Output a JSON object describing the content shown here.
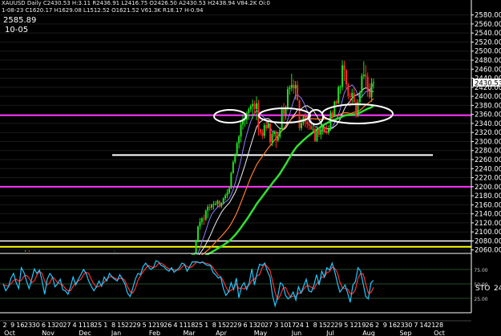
{
  "header": {
    "line1": "XAUUSD Daily  C2430.53 H:3.11 R2436.91 L2416.75 O2426.50 A2430.53 H2438.94  V84.2K  Oi:0",
    "line2": "1-08-23 C1620.17 H1629.08 L1512.52 O1621.52 V61.3K R18.17 H-0.94",
    "price_readout": "2585.89",
    "date_readout": "10-05"
  },
  "colors": {
    "background": "#000000",
    "up_candle": "#22e022",
    "down_candle": "#ff2a2a",
    "magenta_line": "#ff33ff",
    "white_line": "#ffffff",
    "yellow_line": "#ffff00",
    "ma_fast": "#8a7cff",
    "ma_mid": "#f2f2f2",
    "ma_slow": "#ff7a2a",
    "ma_long": "#33dd33",
    "sto_k": "#22c8ff",
    "sto_d": "#ff3030",
    "grid": "#d0d0d0"
  },
  "chart_data": {
    "type": "candlestick",
    "y_axis": {
      "range": [
        2056,
        2590
      ],
      "ticks": [
        2580,
        2560,
        2540,
        2520,
        2500,
        2480,
        2460,
        2440,
        2420,
        2400,
        2380,
        2360,
        2340,
        2320,
        2300,
        2280,
        2260,
        2240,
        2220,
        2200,
        2180,
        2160,
        2140,
        2120,
        2100,
        2080,
        2060
      ],
      "tick_labels": [
        "2580.00",
        "2560.00",
        "2540.00",
        "2520.00",
        "2500.00",
        "2480.00",
        "2460.00",
        "2440.00",
        "2420.00",
        "2400.00",
        "2380.00",
        "2360.00",
        "2340.00",
        "2320.00",
        "2300.00",
        "2280.00",
        "2260.00",
        "2240.00",
        "2220.00",
        "2200.00",
        "2180.00",
        "2160.00",
        "2140.00",
        "2120.00",
        "2100.00",
        "2080.00",
        "2060.00"
      ],
      "last_price_label": "2430.53",
      "last_price": 2430.53
    },
    "x_axis": {
      "day_labels": [
        "2",
        "9",
        "16",
        "23",
        "30",
        "6",
        "13",
        "20",
        "27",
        "4",
        "11",
        "18",
        "25",
        "1",
        "8",
        "15",
        "22",
        "29",
        "5",
        "12",
        "19",
        "26",
        "4",
        "11",
        "18",
        "25",
        "1",
        "8",
        "15",
        "22",
        "29",
        "6",
        "13",
        "20",
        "27",
        "3",
        "10",
        "17",
        "24",
        "1",
        "8",
        "15",
        "22",
        "29",
        "5",
        "12",
        "19",
        "26",
        "2",
        "9",
        "16",
        "23",
        "30",
        "7",
        "14",
        "21",
        "28"
      ],
      "month_labels": [
        "Oct",
        "Nov",
        "Dec",
        "Jan",
        "Feb",
        "Mar",
        "Apr",
        "May",
        "Jun",
        "Jul",
        "Aug",
        "Sep",
        "Oct"
      ]
    },
    "price_series": [
      [
        2031.5,
        2040.0,
        2031.0,
        2039.2
      ],
      [
        2039.2,
        2043.5,
        2033.3,
        2035.9
      ],
      [
        2035.9,
        2045.4,
        2029.8,
        2032.7
      ],
      [
        2032.7,
        2045.0,
        2022.4,
        2042.8
      ],
      [
        2042.8,
        2048.2,
        2036.7,
        2039.9
      ],
      [
        2039.9,
        2042.8,
        2037.7,
        2040.8
      ],
      [
        2040.8,
        2059.9,
        2038.4,
        2057.9
      ],
      [
        2057.9,
        2059.6,
        2037.9,
        2042.2
      ],
      [
        2042.2,
        2045.1,
        2030.0,
        2034.8
      ],
      [
        2034.8,
        2037.0,
        2033.7,
        2036.2
      ],
      [
        2036.2,
        2044.9,
        2028.6,
        2041.4
      ],
      [
        2041.4,
        2051.1,
        2039.1,
        2048.5
      ],
      [
        2048.5,
        2052.8,
        2032.7,
        2035.3
      ],
      [
        2035.3,
        2038.8,
        2030.1,
        2036.1
      ],
      [
        2036.1,
        2039.1,
        2034.4,
        2036.3
      ],
      [
        2036.3,
        2037.5,
        2017.5,
        2024.1
      ],
      [
        2024.1,
        2042.7,
        2012.3,
        2037.5
      ],
      [
        2037.5,
        2045.3,
        2033.3,
        2042.4
      ],
      [
        2042.4,
        2049.8,
        2034.5,
        2036.6
      ],
      [
        2036.6,
        2037.9,
        2032.9,
        2036.1
      ],
      [
        2036.1,
        2044.4,
        2031.5,
        2038.8
      ],
      [
        2038.8,
        2044.4,
        2033.0,
        2034.2
      ],
      [
        2034.2,
        2034.3,
        2025.8,
        2031.9
      ],
      [
        2031.9,
        2033.9,
        2021.3,
        2023.2
      ],
      [
        2023.2,
        2032.1,
        2018.8,
        2032.0
      ],
      [
        2032.0,
        2050.0,
        2028.0,
        2047.4
      ],
      [
        2047.4,
        2050.0,
        2032.4,
        2036.9
      ],
      [
        2036.9,
        2045.9,
        2032.5,
        2042.2
      ],
      [
        2042.2,
        2046.5,
        2040.3,
        2044.5
      ],
      [
        2044.5,
        2050.8,
        2040.3,
        2049.6
      ],
      [
        2049.6,
        2057.1,
        2041.1,
        2052.2
      ],
      [
        2052.2,
        2053.5,
        2042.4,
        2047.0
      ],
      [
        2047.0,
        2052.3,
        2044.6,
        2048.6
      ],
      [
        2048.6,
        2050.7,
        2044.0,
        2045.3
      ],
      [
        2045.3,
        2046.1,
        2037.1,
        2037.7
      ],
      [
        2037.7,
        2039.2,
        2031.2,
        2032.2
      ],
      [
        2032.2,
        2040.0,
        2029.1,
        2036.0
      ],
      [
        2036.0,
        2039.1,
        2032.9,
        2034.1
      ],
      [
        2034.1,
        2039.7,
        2029.2,
        2038.7
      ],
      [
        2038.7,
        2040.4,
        2032.9,
        2037.3
      ],
      [
        2037.3,
        2044.0,
        2033.8,
        2040.3
      ],
      [
        2040.3,
        2045.3,
        2037.1,
        2038.9
      ],
      [
        2038.9,
        2041.6,
        2032.3,
        2039.9
      ],
      [
        2039.9,
        2043.5,
        2032.6,
        2039.1
      ],
      [
        2039.1,
        2040.7,
        2034.5,
        2037.6
      ],
      [
        2037.6,
        2043.0,
        2032.6,
        2039.6
      ],
      [
        2039.6,
        2041.6,
        2035.6,
        2039.7
      ],
      [
        2039.7,
        2042.5,
        2034.6,
        2036.7
      ],
      [
        2036.7,
        2039.2,
        2021.1,
        2022.9
      ],
      [
        2022.9,
        2025.8,
        2015.4,
        2020.2
      ],
      [
        2020.2,
        2036.6,
        2014.9,
        2035.6
      ],
      [
        2035.6,
        2044.4,
        2034.0,
        2041.7
      ],
      [
        2041.7,
        2053.4,
        2038.7,
        2050.2
      ],
      [
        2050.2,
        2054.2,
        2044.7,
        2050.9
      ],
      [
        2050.9,
        2083.1,
        2049.7,
        2082.2
      ],
      [
        2082.2,
        2114.1,
        2076.8,
        2112.0
      ],
      [
        2112.0,
        2130.9,
        2104.8,
        2122.3
      ],
      [
        2122.3,
        2133.0,
        2115.4,
        2129.7
      ],
      [
        2129.7,
        2137.6,
        2115.1,
        2127.8
      ],
      [
        2127.8,
        2149.4,
        2123.9,
        2147.3
      ],
      [
        2147.3,
        2160.4,
        2130.5,
        2155.1
      ],
      [
        2155.1,
        2162.4,
        2146.3,
        2154.0
      ],
      [
        2154.0,
        2162.3,
        2148.5,
        2160.6
      ],
      [
        2160.6,
        2168.4,
        2149.4,
        2161.6
      ],
      [
        2161.6,
        2168.4,
        2158.4,
        2162.3
      ],
      [
        2162.3,
        2171.6,
        2155.6,
        2168.6
      ],
      [
        2168.6,
        2170.6,
        2152.6,
        2156.3
      ],
      [
        2156.3,
        2165.8,
        2152.4,
        2164.4
      ],
      [
        2164.4,
        2176.6,
        2160.8,
        2174.6
      ],
      [
        2174.6,
        2184.7,
        2169.7,
        2180.9
      ],
      [
        2180.9,
        2194.5,
        2174.4,
        2186.5
      ],
      [
        2186.5,
        2199.4,
        2183.6,
        2197.0
      ],
      [
        2197.0,
        2233.5,
        2194.5,
        2230.4
      ],
      [
        2230.4,
        2258.6,
        2228.5,
        2254.6
      ],
      [
        2254.6,
        2273.8,
        2250.6,
        2270.1
      ],
      [
        2270.1,
        2299.7,
        2266.8,
        2296.4
      ],
      [
        2296.4,
        2314.5,
        2284.3,
        2310.8
      ],
      [
        2310.8,
        2343.1,
        2298.3,
        2337.4
      ],
      [
        2337.4,
        2359.7,
        2326.4,
        2346.1
      ],
      [
        2346.1,
        2357.4,
        2332.6,
        2348.3
      ],
      [
        2348.3,
        2367.1,
        2338.4,
        2362.9
      ],
      [
        2362.9,
        2375.8,
        2348.1,
        2371.8
      ],
      [
        2371.8,
        2381.9,
        2365.4,
        2378.4
      ],
      [
        2378.4,
        2392.7,
        2350.0,
        2383.3
      ],
      [
        2383.3,
        2390.3,
        2360.4,
        2372.1
      ],
      [
        2372.1,
        2399.7,
        2347.1,
        2384.7
      ],
      [
        2384.7,
        2392.3,
        2313.0,
        2327.3
      ],
      [
        2327.3,
        2328.0,
        2313.8,
        2320.0
      ],
      [
        2320.0,
        2327.1,
        2305.1,
        2312.8
      ],
      [
        2312.8,
        2340.8,
        2306.8,
        2336.2
      ],
      [
        2336.2,
        2343.4,
        2323.0,
        2329.2
      ],
      [
        2329.2,
        2347.2,
        2328.4,
        2339.6
      ],
      [
        2339.6,
        2340.8,
        2293.5,
        2298.2
      ],
      [
        2298.2,
        2321.3,
        2290.1,
        2316.7
      ],
      [
        2316.7,
        2325.5,
        2310.4,
        2321.8
      ],
      [
        2321.8,
        2324.9,
        2286.0,
        2302.1
      ],
      [
        2302.1,
        2321.0,
        2298.3,
        2310.5
      ],
      [
        2310.5,
        2331.8,
        2306.5,
        2326.4
      ],
      [
        2326.4,
        2378.1,
        2322.2,
        2374.6
      ],
      [
        2374.6,
        2385.3,
        2342.6,
        2360.2
      ],
      [
        2360.2,
        2379.2,
        2348.5,
        2373.8
      ],
      [
        2373.8,
        2422.5,
        2368.9,
        2416.0
      ],
      [
        2416.0,
        2424.2,
        2403.2,
        2418.8
      ],
      [
        2418.8,
        2450.1,
        2411.0,
        2425.4
      ],
      [
        2425.4,
        2437.6,
        2405.8,
        2417.6
      ],
      [
        2417.6,
        2433.9,
        2392.9,
        2424.7
      ],
      [
        2424.7,
        2434.4,
        2390.6,
        2391.5
      ],
      [
        2391.5,
        2392.4,
        2324.0,
        2329.6
      ],
      [
        2329.6,
        2350.4,
        2324.0,
        2340.7
      ],
      [
        2340.7,
        2357.5,
        2335.2,
        2353.8
      ],
      [
        2353.8,
        2363.7,
        2331.7,
        2343.8
      ],
      [
        2343.8,
        2360.1,
        2328.8,
        2338.4
      ],
      [
        2338.4,
        2351.5,
        2325.5,
        2335.2
      ],
      [
        2335.2,
        2340.8,
        2325.9,
        2327.3
      ],
      [
        2327.3,
        2340.7,
        2321.4,
        2327.7
      ],
      [
        2327.7,
        2333.6,
        2298.9,
        2301.2
      ],
      [
        2301.2,
        2334.8,
        2298.6,
        2326.2
      ],
      [
        2326.2,
        2330.4,
        2309.7,
        2315.4
      ],
      [
        2315.4,
        2346.1,
        2304.9,
        2325.3
      ],
      [
        2325.3,
        2334.3,
        2314.8,
        2331.3
      ],
      [
        2331.3,
        2333.3,
        2318.1,
        2320.3
      ],
      [
        2320.3,
        2337.3,
        2315.8,
        2319.8
      ],
      [
        2319.8,
        2336.0,
        2314.9,
        2327.6
      ],
      [
        2327.6,
        2369.3,
        2323.9,
        2364.0
      ],
      [
        2364.0,
        2369.2,
        2348.9,
        2355.0
      ],
      [
        2355.0,
        2390.1,
        2353.9,
        2388.5
      ],
      [
        2388.5,
        2392.8,
        2380.8,
        2384.4
      ],
      [
        2384.4,
        2424.0,
        2383.0,
        2420.4
      ],
      [
        2420.4,
        2424.8,
        2405.5,
        2420.7
      ],
      [
        2420.7,
        2479.2,
        2413.0,
        2468.6
      ],
      [
        2468.6,
        2478.5,
        2433.8,
        2458.3
      ],
      [
        2458.3,
        2460.0,
        2414.1,
        2426.2
      ],
      [
        2426.2,
        2430.1,
        2393.5,
        2400.4
      ],
      [
        2400.4,
        2407.9,
        2377.6,
        2398.6
      ],
      [
        2398.6,
        2416.6,
        2383.4,
        2407.6
      ],
      [
        2407.6,
        2419.7,
        2384.4,
        2386.3
      ],
      [
        2386.3,
        2393.4,
        2352.8,
        2357.5
      ],
      [
        2357.5,
        2393.5,
        2353.5,
        2387.3
      ],
      [
        2387.3,
        2412.1,
        2379.4,
        2409.1
      ],
      [
        2409.1,
        2450.9,
        2396.9,
        2445.2
      ],
      [
        2445.2,
        2477.6,
        2438.2,
        2448.3
      ],
      [
        2448.3,
        2469.1,
        2420.2,
        2443.0
      ],
      [
        2443.0,
        2452.9,
        2399.0,
        2410.7
      ],
      [
        2410.7,
        2428.7,
        2393.7,
        2398.0
      ],
      [
        2398.0,
        2440.4,
        2387.8,
        2429.3
      ],
      [
        2429.3,
        2438.9,
        2416.8,
        2430.5
      ]
    ],
    "horizontal_lines": [
      {
        "price": 2358,
        "color": "magenta"
      },
      {
        "price": 2270,
        "color": "white"
      },
      {
        "price": 2200,
        "color": "magenta"
      },
      {
        "price": 2080,
        "color": "white"
      },
      {
        "price": 2067,
        "color": "yellow"
      }
    ],
    "indicator": {
      "name": "STO",
      "value_label": "24",
      "levels": [
        75,
        50,
        25
      ],
      "k": [
        50,
        38,
        45,
        60,
        68,
        52,
        42,
        78,
        70,
        55,
        42,
        58,
        76,
        68,
        74,
        55,
        32,
        58,
        68,
        62,
        45,
        50,
        58,
        40,
        38,
        32,
        45,
        62,
        48,
        58,
        66,
        75,
        68,
        55,
        46,
        38,
        45,
        55,
        46,
        62,
        55,
        68,
        62,
        58,
        55,
        66,
        58,
        50,
        34,
        28,
        42,
        58,
        68,
        66,
        80,
        86,
        80,
        75,
        78,
        90,
        88,
        82,
        80,
        75,
        72,
        78,
        70,
        74,
        78,
        86,
        84,
        72,
        80,
        88,
        88,
        88,
        86,
        88,
        84,
        82,
        82,
        70,
        66,
        60,
        62,
        42,
        30,
        36,
        52,
        40,
        60,
        26,
        45,
        52,
        40,
        52,
        76,
        48,
        68,
        84,
        82,
        86,
        72,
        62,
        30,
        12,
        28,
        52,
        48,
        30,
        24,
        28,
        36,
        22,
        45,
        34,
        46,
        58,
        38,
        36,
        48,
        66,
        48,
        72,
        62,
        78,
        74,
        86,
        72,
        52,
        36,
        42,
        48,
        34,
        18,
        48,
        54,
        78,
        72,
        50,
        28,
        24,
        52,
        56
      ],
      "d": [
        48,
        47,
        46,
        50,
        56,
        58,
        55,
        56,
        63,
        65,
        60,
        52,
        55,
        65,
        72,
        68,
        55,
        48,
        52,
        62,
        58,
        52,
        50,
        48,
        42,
        38,
        38,
        46,
        52,
        55,
        58,
        66,
        70,
        68,
        58,
        50,
        44,
        46,
        48,
        53,
        58,
        62,
        63,
        60,
        58,
        59,
        60,
        56,
        45,
        37,
        34,
        42,
        56,
        64,
        71,
        77,
        82,
        80,
        78,
        80,
        85,
        86,
        83,
        79,
        76,
        75,
        74,
        74,
        74,
        79,
        83,
        80,
        78,
        80,
        85,
        88,
        87,
        87,
        86,
        85,
        83,
        78,
        72,
        65,
        62,
        55,
        45,
        36,
        39,
        42,
        50,
        42,
        43,
        41,
        45,
        48,
        56,
        58,
        64,
        66,
        78,
        84,
        80,
        73,
        55,
        35,
        23,
        30,
        42,
        44,
        34,
        27,
        29,
        28,
        34,
        34,
        41,
        46,
        47,
        44,
        41,
        50,
        54,
        62,
        61,
        70,
        71,
        79,
        77,
        70,
        53,
        43,
        42,
        41,
        33,
        33,
        40,
        60,
        68,
        67,
        50,
        34,
        35,
        44
      ]
    }
  }
}
